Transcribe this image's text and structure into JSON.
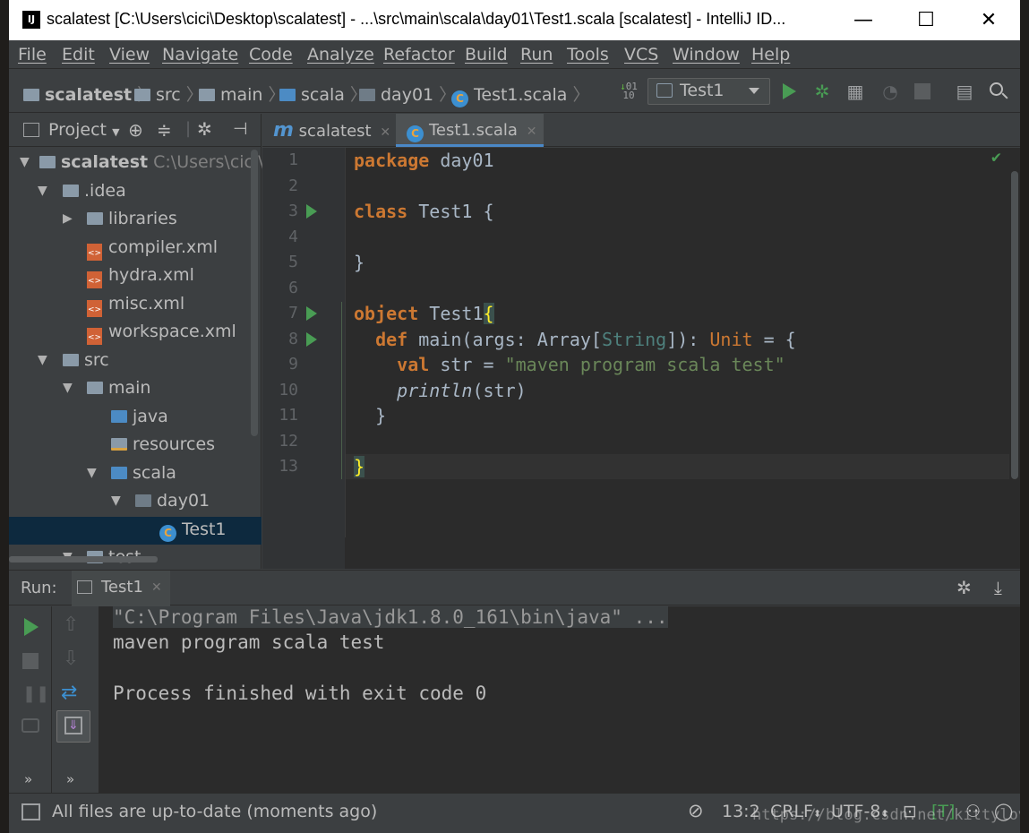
{
  "window": {
    "title": "scalatest [C:\\Users\\cici\\Desktop\\scalatest] - ...\\src\\main\\scala\\day01\\Test1.scala [scalatest] - IntelliJ ID...",
    "app_icon": "IJ",
    "minimize": "—",
    "maximize": "☐",
    "close": "✕"
  },
  "menu": [
    "File",
    "Edit",
    "View",
    "Navigate",
    "Code",
    "Analyze",
    "Refactor",
    "Build",
    "Run",
    "Tools",
    "VCS",
    "Window",
    "Help"
  ],
  "breadcrumbs": [
    "scalatest",
    "src",
    "main",
    "scala",
    "day01",
    "Test1.scala"
  ],
  "toolbar": {
    "run_config": "Test1"
  },
  "project_panel": {
    "title": "Project",
    "tree": [
      {
        "label": "scalatest",
        "hint": "C:\\Users\\cici\\De",
        "icon": "module-folder-icon"
      },
      {
        "label": ".idea",
        "icon": "folder-icon"
      },
      {
        "label": "libraries",
        "icon": "folder-icon"
      },
      {
        "label": "compiler.xml",
        "icon": "xml-file-icon"
      },
      {
        "label": "hydra.xml",
        "icon": "xml-file-icon"
      },
      {
        "label": "misc.xml",
        "icon": "xml-file-icon"
      },
      {
        "label": "workspace.xml",
        "icon": "xml-file-icon"
      },
      {
        "label": "src",
        "icon": "folder-icon"
      },
      {
        "label": "main",
        "icon": "folder-icon"
      },
      {
        "label": "java",
        "icon": "source-folder-icon"
      },
      {
        "label": "resources",
        "icon": "resources-folder-icon"
      },
      {
        "label": "scala",
        "icon": "source-folder-icon"
      },
      {
        "label": "day01",
        "icon": "package-icon"
      },
      {
        "label": "Test1",
        "icon": "scala-class-icon"
      },
      {
        "label": "test",
        "icon": "folder-icon"
      }
    ]
  },
  "editor": {
    "tabs": [
      {
        "label": "scalatest",
        "icon": "maven-m-icon"
      },
      {
        "label": "Test1.scala",
        "icon": "scala-class-icon"
      }
    ],
    "line_numbers": [
      "1",
      "2",
      "3",
      "4",
      "5",
      "6",
      "7",
      "8",
      "9",
      "10",
      "11",
      "12",
      "13"
    ],
    "code": {
      "l1_kw": "package",
      "l1_rest": " day01",
      "l3_kw": "class",
      "l3_rest": " Test1 {",
      "l5": "}",
      "l7_kw": "object",
      "l7_rest": " Test1",
      "l7_brace": "{",
      "l8_kw": "def",
      "l8_a": " main(args: Array[",
      "l8_type": "String",
      "l8_b": "]): ",
      "l8_unit": "Unit",
      "l8_c": " = {",
      "l9_kw": "val",
      "l9_a": " str = ",
      "l9_str": "\"maven program scala test\"",
      "l10_fn": "println",
      "l10_rest": "(str)",
      "l11": "}",
      "l13": "}"
    },
    "check_mark": "✔"
  },
  "run_panel": {
    "label": "Run:",
    "tab": "Test1",
    "console": [
      "\"C:\\Program Files\\Java\\jdk1.8.0_161\\bin\\java\" ...",
      "maven program scala test",
      "",
      "Process finished with exit code 0"
    ],
    "more": "»"
  },
  "status_bar": {
    "message": "All files are up-to-date (moments ago)",
    "position": "13:2",
    "line_sep": "CRLF",
    "encoding": "UTF-8",
    "watermark": "https://blog.csdn.net/kittylove"
  }
}
